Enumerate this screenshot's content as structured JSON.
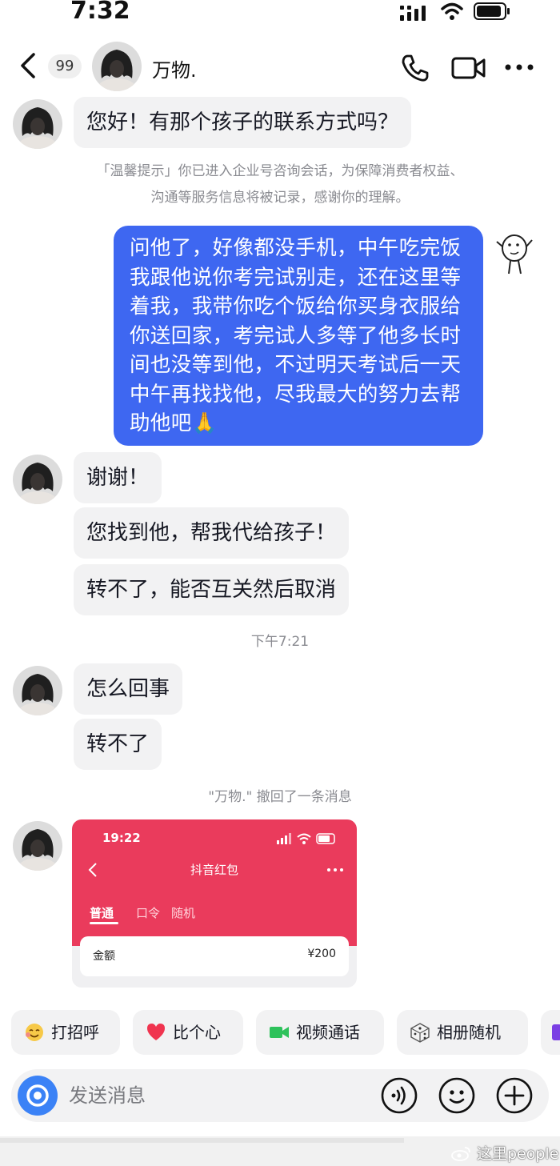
{
  "status_bar": {
    "time": "7:32"
  },
  "header": {
    "unread_count": "99",
    "contact_name": "万物."
  },
  "messages": {
    "m1": "您好！有那个孩子的联系方式吗？",
    "tip_line1": "「温馨提示」你已进入企业号咨询会话，为保障消费者权益、",
    "tip_line2": "沟通等服务信息将被记录，感谢你的理解。",
    "out_message": "问他了，好像都没手机，中午吃完饭我跟他说你考完试别走，还在这里等着我，我带你吃个饭给你买身衣服给你送回家，考完试人多等了他多长时间也没等到他，不过明天考试后一天中午再找找他，尽我最大的努力去帮助他吧🙏",
    "m2": "谢谢！",
    "m3": "您找到他，帮我代给孩子！",
    "m4": "转不了，能否互关然后取消",
    "timestamp": "下午7:21",
    "m5": "怎么回事",
    "m6": "转不了",
    "recall_notice": "\"万物.\" 撤回了一条消息"
  },
  "red_packet_card": {
    "time": "19:22",
    "title": "抖音红包",
    "tabs": [
      "普通",
      "口令",
      "随机"
    ],
    "amount_label": "金额",
    "amount_value": "¥200"
  },
  "quick_actions": [
    {
      "label": "打招呼",
      "icon": "wave-face-icon"
    },
    {
      "label": "比个心",
      "icon": "heart-icon"
    },
    {
      "label": "视频通话",
      "icon": "video-camera-icon"
    },
    {
      "label": "相册随机",
      "icon": "dice-icon"
    }
  ],
  "input": {
    "placeholder": "发送消息"
  },
  "watermark": "这里people",
  "colors": {
    "out_bubble": "#3e67f1",
    "camera_blue": "#3b82f6",
    "red_packet": "#ea3b5c",
    "in_bubble": "#f2f2f3"
  }
}
